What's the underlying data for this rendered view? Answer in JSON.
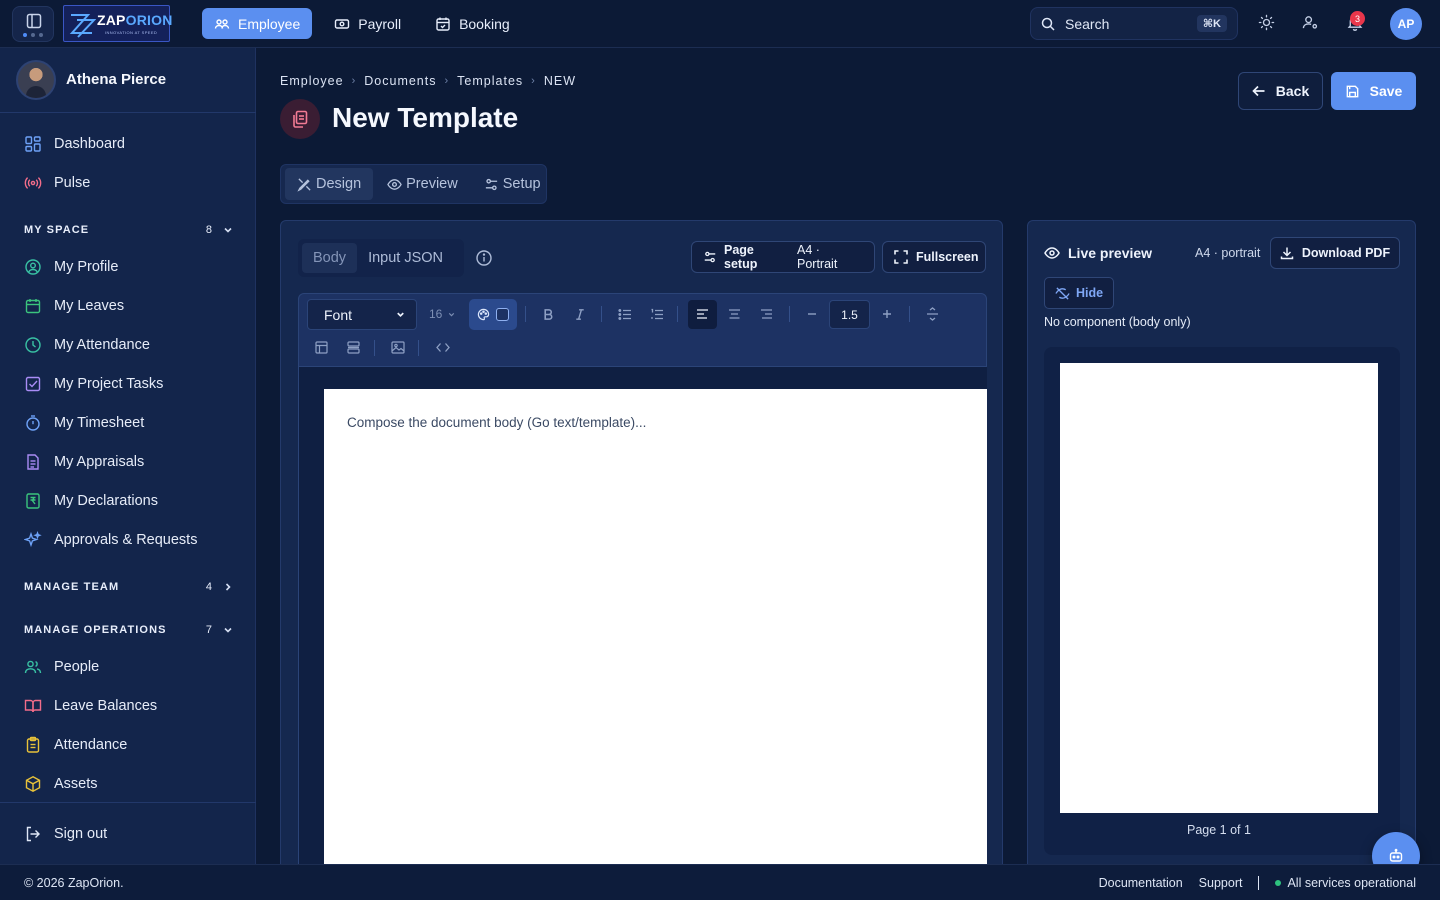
{
  "brand": {
    "logo_main": "ZAP",
    "logo_accent": "ORION",
    "logo_tagline": "INNOVATION AT SPEED"
  },
  "topnav": {
    "modules": [
      {
        "label": "Employee",
        "icon": "users-icon",
        "active": true
      },
      {
        "label": "Payroll",
        "icon": "banknote-icon",
        "active": false
      },
      {
        "label": "Booking",
        "icon": "calendar-check-icon",
        "active": false
      }
    ],
    "search_placeholder": "Search",
    "search_shortcut": "⌘K",
    "notification_count": "3",
    "user_initials": "AP"
  },
  "sidebar": {
    "user_name": "Athena Pierce",
    "top_items": [
      {
        "label": "Dashboard",
        "icon": "grid-icon"
      },
      {
        "label": "Pulse",
        "icon": "radio-icon"
      }
    ],
    "my_space": {
      "title": "MY SPACE",
      "count": "8",
      "expanded": true,
      "items": [
        {
          "label": "My Profile",
          "icon": "user-circle-icon"
        },
        {
          "label": "My Leaves",
          "icon": "calendar-icon"
        },
        {
          "label": "My Attendance",
          "icon": "clock-icon"
        },
        {
          "label": "My Project Tasks",
          "icon": "checkbox-icon"
        },
        {
          "label": "My Timesheet",
          "icon": "timer-icon"
        },
        {
          "label": "My Appraisals",
          "icon": "file-text-icon"
        },
        {
          "label": "My Declarations",
          "icon": "rupee-file-icon"
        },
        {
          "label": "Approvals & Requests",
          "icon": "sparkles-icon"
        }
      ]
    },
    "manage_team": {
      "title": "MANAGE TEAM",
      "count": "4",
      "expanded": false
    },
    "manage_operations": {
      "title": "MANAGE OPERATIONS",
      "count": "7",
      "expanded": true,
      "items": [
        {
          "label": "People",
          "icon": "users-icon"
        },
        {
          "label": "Leave Balances",
          "icon": "book-open-icon"
        },
        {
          "label": "Attendance",
          "icon": "clipboard-icon"
        },
        {
          "label": "Assets",
          "icon": "box-icon"
        }
      ]
    },
    "sign_out": "Sign out"
  },
  "page": {
    "breadcrumb": [
      "Employee",
      "Documents",
      "Templates",
      "NEW"
    ],
    "title": "New Template",
    "back_label": "Back",
    "save_label": "Save",
    "mode_tabs": [
      {
        "label": "Design",
        "active": true
      },
      {
        "label": "Preview",
        "active": false
      },
      {
        "label": "Setup",
        "active": false
      }
    ]
  },
  "editor": {
    "sub_tabs": [
      {
        "label": "Body",
        "active": true
      },
      {
        "label": "Input JSON",
        "active": false
      }
    ],
    "page_setup_label": "Page setup",
    "page_setup_value": "A4 · Portrait",
    "fullscreen_label": "Fullscreen",
    "toolbar": {
      "font": "Font",
      "font_size": "16",
      "line_height": "1.5",
      "align": "left"
    },
    "body_placeholder": "Compose the document body (Go text/template)..."
  },
  "preview": {
    "title": "Live preview",
    "page_size": "A4 · portrait",
    "download_label": "Download PDF",
    "hide_label": "Hide",
    "component_note": "No component (body only)",
    "page_indicator": "Page 1 of 1"
  },
  "footer": {
    "copyright": "© 2026 ZapOrion.",
    "documentation": "Documentation",
    "support": "Support",
    "status": "All services operational",
    "status_color": "#2ec27e"
  },
  "colors": {
    "accent": "#5b8ff0",
    "background": "#0c1a36",
    "sidebar": "#13254b",
    "danger": "#e8364b"
  }
}
